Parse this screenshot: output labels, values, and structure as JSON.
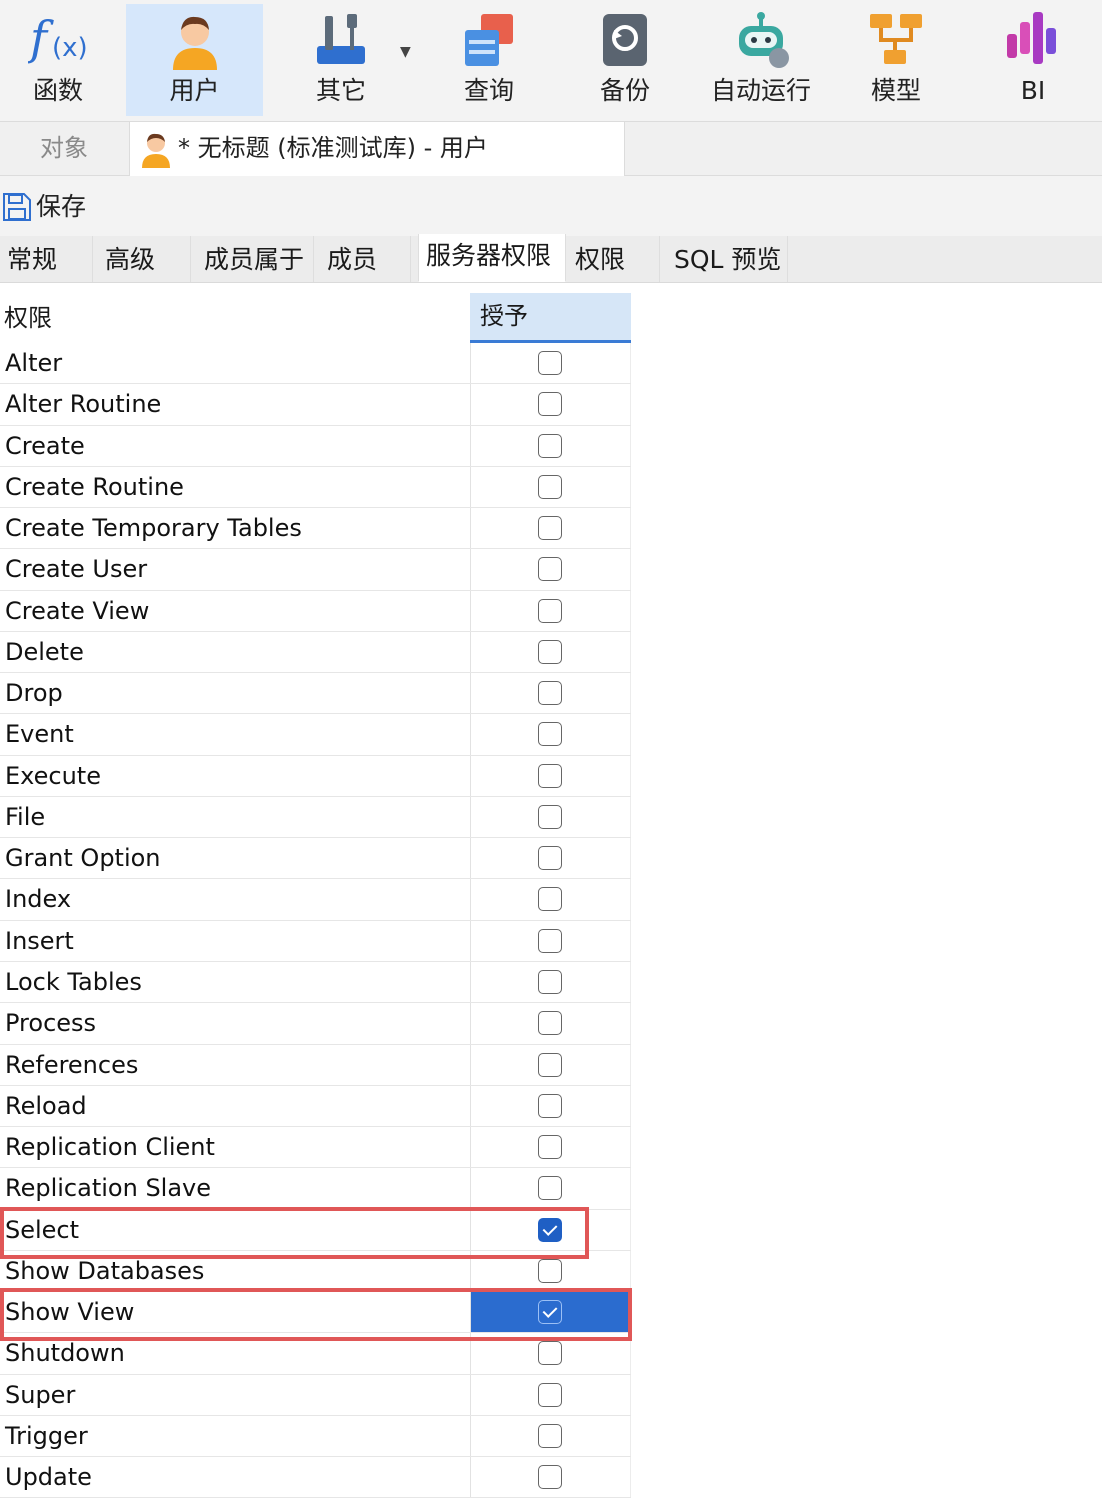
{
  "toolbar": {
    "items": [
      {
        "label": "函数",
        "icon": "function-icon"
      },
      {
        "label": "用户",
        "icon": "user-icon",
        "active": true
      },
      {
        "label": "其它",
        "icon": "tools-icon"
      },
      {
        "label": "查询",
        "icon": "query-icon"
      },
      {
        "label": "备份",
        "icon": "backup-icon"
      },
      {
        "label": "自动运行",
        "icon": "robot-icon"
      },
      {
        "label": "模型",
        "icon": "model-icon"
      },
      {
        "label": "BI",
        "icon": "bi-icon"
      }
    ]
  },
  "object_tab": {
    "label": "对象"
  },
  "document_tab": {
    "title": "* 无标题 (标准测试库) - 用户",
    "icon": "user-icon"
  },
  "save": {
    "label": "保存",
    "icon": "save-icon"
  },
  "tabs": [
    {
      "label": "常规"
    },
    {
      "label": "高级"
    },
    {
      "label": "成员属于"
    },
    {
      "label": "成员"
    },
    {
      "label": "服务器权限",
      "active": true
    },
    {
      "label": "权限"
    },
    {
      "label": "SQL 预览"
    }
  ],
  "grid": {
    "headers": {
      "name": "权限",
      "grant": "授予"
    },
    "rows": [
      {
        "name": "Alter",
        "grant": false
      },
      {
        "name": "Alter Routine",
        "grant": false
      },
      {
        "name": "Create",
        "grant": false
      },
      {
        "name": "Create Routine",
        "grant": false
      },
      {
        "name": "Create Temporary Tables",
        "grant": false
      },
      {
        "name": "Create User",
        "grant": false
      },
      {
        "name": "Create View",
        "grant": false
      },
      {
        "name": "Delete",
        "grant": false
      },
      {
        "name": "Drop",
        "grant": false
      },
      {
        "name": "Event",
        "grant": false
      },
      {
        "name": "Execute",
        "grant": false
      },
      {
        "name": "File",
        "grant": false
      },
      {
        "name": "Grant Option",
        "grant": false
      },
      {
        "name": "Index",
        "grant": false
      },
      {
        "name": "Insert",
        "grant": false
      },
      {
        "name": "Lock Tables",
        "grant": false
      },
      {
        "name": "Process",
        "grant": false
      },
      {
        "name": "References",
        "grant": false
      },
      {
        "name": "Reload",
        "grant": false
      },
      {
        "name": "Replication Client",
        "grant": false
      },
      {
        "name": "Replication Slave",
        "grant": false
      },
      {
        "name": "Select",
        "grant": true,
        "highlighted": true
      },
      {
        "name": "Show Databases",
        "grant": false
      },
      {
        "name": "Show View",
        "grant": true,
        "highlighted": true,
        "selected": true
      },
      {
        "name": "Shutdown",
        "grant": false
      },
      {
        "name": "Super",
        "grant": false
      },
      {
        "name": "Trigger",
        "grant": false
      },
      {
        "name": "Update",
        "grant": false
      }
    ]
  },
  "colors": {
    "accent": "#1f5fc4",
    "highlight": "#e05757",
    "active_bg": "#d6e7fb"
  }
}
